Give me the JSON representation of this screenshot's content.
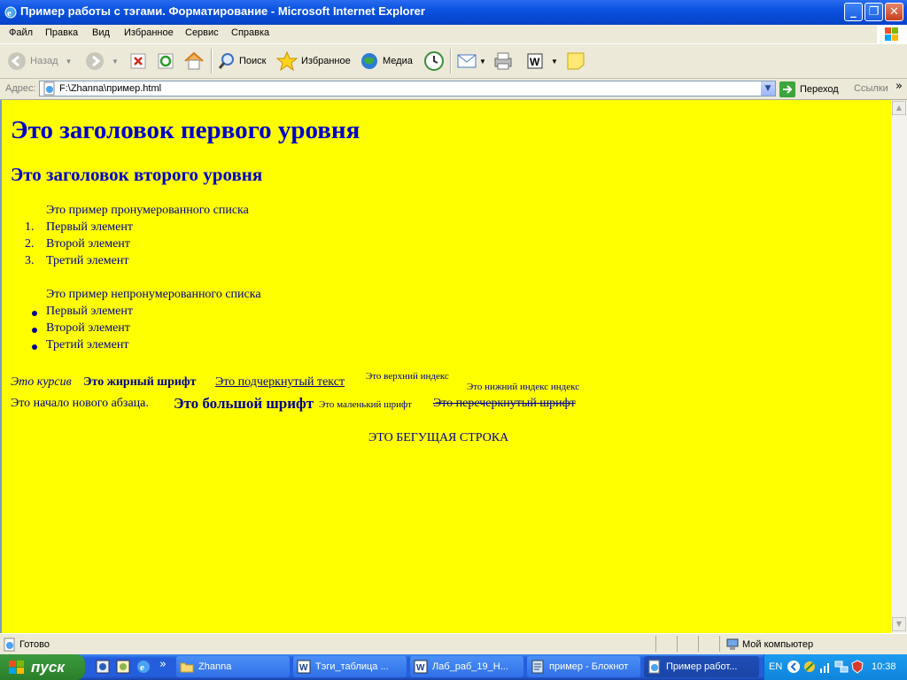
{
  "window": {
    "title": "Пример работы с тэгами. Форматирование - Microsoft Internet Explorer",
    "minimize": "_",
    "maximize": "❐",
    "close": "✕"
  },
  "menu": [
    "Файл",
    "Правка",
    "Вид",
    "Избранное",
    "Сервис",
    "Справка"
  ],
  "toolbar": {
    "back": "Назад",
    "search": "Поиск",
    "favorites": "Избранное",
    "media": "Медиа"
  },
  "address": {
    "label": "Адрес:",
    "value": "F:\\Zhanna\\пример.html",
    "go": "Переход",
    "links": "Ссылки",
    "more": "»"
  },
  "page": {
    "h1": "Это заголовок первого уровня",
    "h2": "Это заголовок второго уровня",
    "ol_caption": "Это пример пронумерованного списка",
    "ol_items": [
      "Первый элемент",
      "Второй элемент",
      "Третий элемент"
    ],
    "ol_numbers": [
      "1.",
      "2.",
      "3."
    ],
    "ul_caption": "Это пример непронумерованного списка",
    "ul_items": [
      "Первый элемент",
      "Второй элемент",
      "Третий элемент"
    ],
    "italic": "Это курсив",
    "bold": "Это жирный шрифт",
    "underline": "Это подчеркнутый текст",
    "superscript": "Это верхний индекс",
    "subscript": "Это нижний индекс индекс",
    "para_start": "Это начало нового абзаца.",
    "big": "Это большой шрифт",
    "small": "Это маленький шрифт",
    "strike": "Это перечеркнутый шрифт",
    "marquee": "ЭТО БЕГУЩАЯ СТРОКА"
  },
  "status": {
    "text": "Готово",
    "zone": "Мой компьютер"
  },
  "taskbar": {
    "start": "пуск",
    "more": "»",
    "tasks": [
      "Zhanna",
      "Тэги_таблица ...",
      "Лаб_раб_19_Н...",
      "пример - Блокнот",
      "Пример работ..."
    ],
    "lang": "EN",
    "clock": "10:38"
  },
  "colors": {
    "page_background": "#FFFF00",
    "text": "#0000CC",
    "titlebar": "#0A52E0"
  }
}
